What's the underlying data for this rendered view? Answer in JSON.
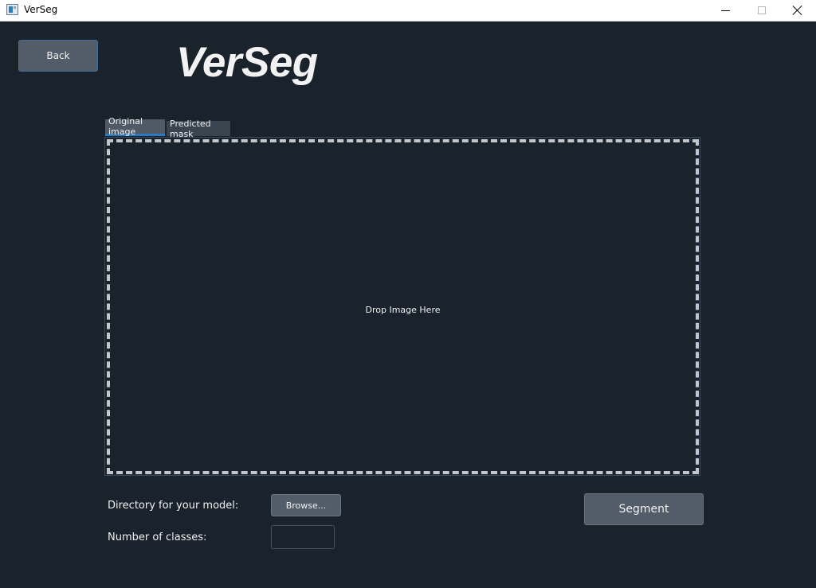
{
  "window": {
    "title": "VerSeg"
  },
  "header": {
    "back_label": "Back",
    "app_title": "VerSeg"
  },
  "tabs": [
    {
      "label": "Original image",
      "active": true
    },
    {
      "label": "Predicted mask",
      "active": false
    }
  ],
  "drop_zone": {
    "text": "Drop Image Here"
  },
  "form": {
    "directory_label": "Directory for your model:",
    "browse_label": "Browse...",
    "classes_label": "Number of classes:",
    "classes_value": "",
    "segment_label": "Segment"
  },
  "colors": {
    "background": "#1a222c",
    "button": "#525d69",
    "accent": "#2d79c0"
  }
}
